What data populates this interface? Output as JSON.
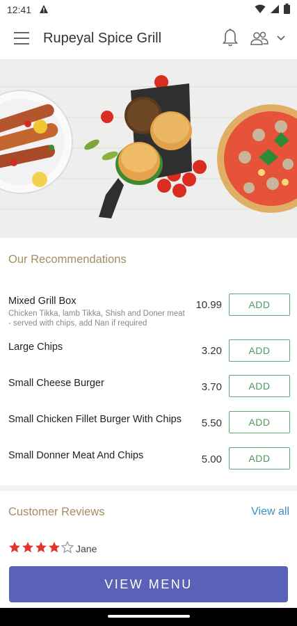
{
  "status_bar": {
    "time": "12:41"
  },
  "app_bar": {
    "title": "Rupeyal Spice Grill"
  },
  "recommendations": {
    "title": "Our Recommendations",
    "add_label": "ADD",
    "items": [
      {
        "name": "Mixed Grill Box",
        "description": "Chicken Tikka, lamb Tikka, Shish and Doner meat - served with chips, add Nan if required",
        "price": "10.99"
      },
      {
        "name": "Large Chips",
        "description": "",
        "price": "3.20"
      },
      {
        "name": "Small Cheese Burger",
        "description": "",
        "price": "3.70"
      },
      {
        "name": "Small Chicken Fillet Burger With Chips",
        "description": "",
        "price": "5.50"
      },
      {
        "name": "Small Donner Meat And Chips",
        "description": "",
        "price": "5.00"
      }
    ]
  },
  "reviews": {
    "title": "Customer Reviews",
    "view_all": "View all",
    "first_review": {
      "reviewer": "Jane",
      "rating": 4,
      "max_rating": 5
    }
  },
  "bottom": {
    "view_menu_label": "VIEW MENU"
  },
  "colors": {
    "accent_gold": "#a48d60",
    "add_green": "#4b9b5f",
    "button_blue": "#5a62b8",
    "link_blue": "#3d8fc0",
    "star_red": "#e0342c"
  }
}
